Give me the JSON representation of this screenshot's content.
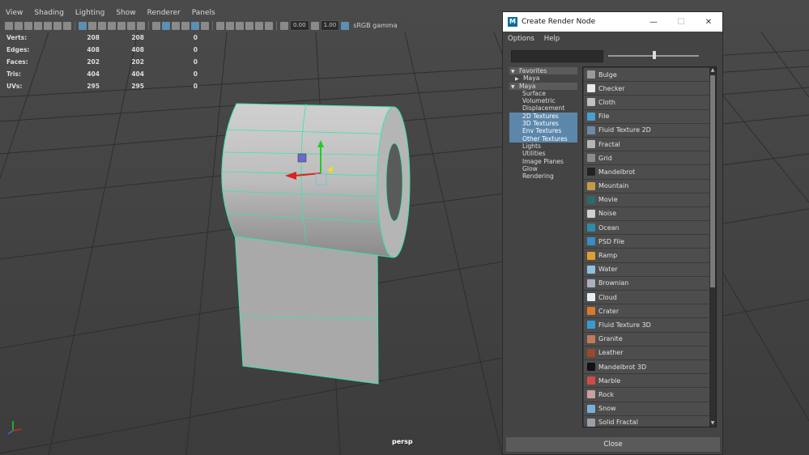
{
  "viewport": {
    "menu": [
      "View",
      "Shading",
      "Lighting",
      "Show",
      "Renderer",
      "Panels"
    ],
    "toolbar": {
      "field1": "0.00",
      "field2": "1.00",
      "gamma_label": "sRGB gamma"
    },
    "hud": [
      {
        "label": "Verts:",
        "a": "208",
        "b": "208",
        "c": "0"
      },
      {
        "label": "Edges:",
        "a": "408",
        "b": "408",
        "c": "0"
      },
      {
        "label": "Faces:",
        "a": "202",
        "b": "202",
        "c": "0"
      },
      {
        "label": "Tris:",
        "a": "404",
        "b": "404",
        "c": "0"
      },
      {
        "label": "UVs:",
        "a": "295",
        "b": "295",
        "c": "0"
      }
    ],
    "camera_label": "persp"
  },
  "dialog": {
    "title": "Create Render Node",
    "logo_letter": "M",
    "menu": {
      "options": "Options",
      "help": "Help"
    },
    "tree": [
      {
        "label": "Favorites",
        "kind": "hdr"
      },
      {
        "label": "Maya",
        "kind": "sub"
      },
      {
        "label": "Maya",
        "kind": "hdr"
      },
      {
        "label": "Surface",
        "kind": "leaf"
      },
      {
        "label": "Volumetric",
        "kind": "leaf"
      },
      {
        "label": "Displacement",
        "kind": "leaf"
      },
      {
        "label": "2D Textures",
        "kind": "sel"
      },
      {
        "label": "3D Textures",
        "kind": "sel"
      },
      {
        "label": "Env Textures",
        "kind": "sel"
      },
      {
        "label": "Other Textures",
        "kind": "sel"
      },
      {
        "label": "Lights",
        "kind": "leaf"
      },
      {
        "label": "Utilities",
        "kind": "leaf"
      },
      {
        "label": "Image Planes",
        "kind": "leaf"
      },
      {
        "label": "Glow",
        "kind": "leaf"
      },
      {
        "label": "Rendering",
        "kind": "leaf"
      }
    ],
    "nodes": [
      {
        "label": "Bulge",
        "color": "#9a9a9a"
      },
      {
        "label": "Checker",
        "color": "#e8e8e8"
      },
      {
        "label": "Cloth",
        "color": "#c0c0c0"
      },
      {
        "label": "File",
        "color": "#4a9fd0"
      },
      {
        "label": "Fluid Texture 2D",
        "color": "#6d8aa5"
      },
      {
        "label": "Fractal",
        "color": "#b5b5b5"
      },
      {
        "label": "Grid",
        "color": "#8c8c8c"
      },
      {
        "label": "Mandelbrot",
        "color": "#222222"
      },
      {
        "label": "Mountain",
        "color": "#c49a4a"
      },
      {
        "label": "Movie",
        "color": "#2f6a6a"
      },
      {
        "label": "Noise",
        "color": "#d0d0d0"
      },
      {
        "label": "Ocean",
        "color": "#2d8aa8"
      },
      {
        "label": "PSD File",
        "color": "#3a8cc6"
      },
      {
        "label": "Ramp",
        "color": "#e0a030"
      },
      {
        "label": "Water",
        "color": "#8fc0e0"
      },
      {
        "label": "Brownian",
        "color": "#aab0c0"
      },
      {
        "label": "Cloud",
        "color": "#e6eef5"
      },
      {
        "label": "Crater",
        "color": "#d8792c"
      },
      {
        "label": "Fluid Texture 3D",
        "color": "#3a9ad0"
      },
      {
        "label": "Granite",
        "color": "#c07a5a"
      },
      {
        "label": "Leather",
        "color": "#9a4a2a"
      },
      {
        "label": "Mandelbrot 3D",
        "color": "#111111"
      },
      {
        "label": "Marble",
        "color": "#d04a4a"
      },
      {
        "label": "Rock",
        "color": "#c9a0a0"
      },
      {
        "label": "Snow",
        "color": "#7ab0d8"
      },
      {
        "label": "Solid Fractal",
        "color": "#9aa0aa"
      }
    ],
    "close_label": "Close"
  }
}
